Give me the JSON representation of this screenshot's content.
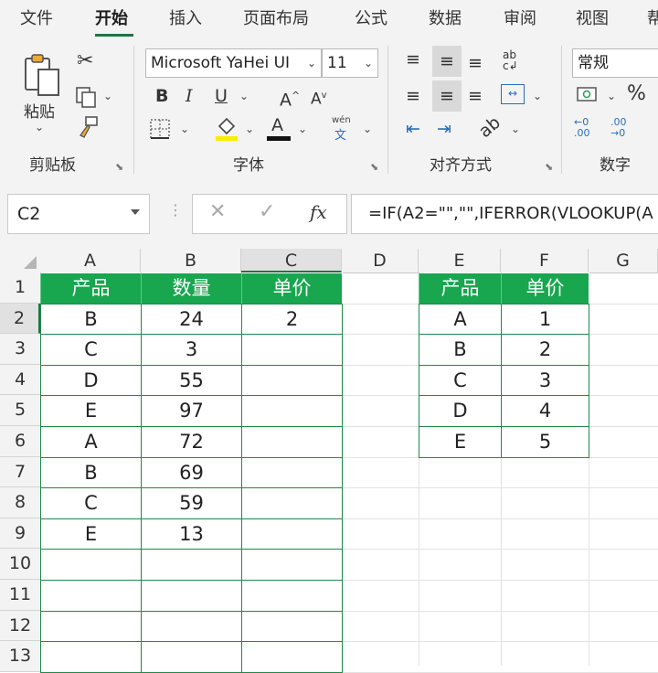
{
  "ribbon": {
    "tabs": [
      "文件",
      "开始",
      "插入",
      "页面布局",
      "公式",
      "数据",
      "审阅",
      "视图",
      "帮"
    ],
    "active_tab": "开始",
    "clipboard": {
      "paste_label": "粘贴",
      "group_label": "剪贴板"
    },
    "font": {
      "font_name": "Microsoft YaHei UI",
      "font_size": "11",
      "group_label": "字体",
      "bold": "B",
      "italic": "I",
      "underline": "U",
      "grow": "A",
      "shrink": "A",
      "font_color_glyph": "A",
      "phonetic_top": "wén",
      "phonetic_bottom": "文"
    },
    "alignment": {
      "group_label": "对齐方式"
    },
    "number": {
      "format": "常规",
      "group_label": "数字",
      "percent": "%"
    }
  },
  "formula_bar": {
    "name_box": "C2",
    "fx": "fx",
    "formula": "=IF(A2=\"\",\"\",IFERROR(VLOOKUP(A"
  },
  "grid": {
    "columns": [
      "A",
      "B",
      "C",
      "D",
      "E",
      "F",
      "G"
    ],
    "rows": [
      "1",
      "2",
      "3",
      "4",
      "5",
      "6",
      "7",
      "8",
      "9",
      "10",
      "11",
      "12",
      "13"
    ],
    "table1": {
      "headers": [
        "产品",
        "数量",
        "单价"
      ],
      "rows": [
        [
          "B",
          "24",
          "2"
        ],
        [
          "C",
          "3",
          ""
        ],
        [
          "D",
          "55",
          ""
        ],
        [
          "E",
          "97",
          ""
        ],
        [
          "A",
          "72",
          ""
        ],
        [
          "B",
          "69",
          ""
        ],
        [
          "C",
          "59",
          ""
        ],
        [
          "E",
          "13",
          ""
        ]
      ]
    },
    "table2": {
      "headers": [
        "产品",
        "单价"
      ],
      "rows": [
        [
          "A",
          "1"
        ],
        [
          "B",
          "2"
        ],
        [
          "C",
          "3"
        ],
        [
          "D",
          "4"
        ],
        [
          "E",
          "5"
        ]
      ]
    }
  },
  "colors": {
    "accent": "#217346",
    "header_fill": "#18a64f",
    "border": "#1e8a4a"
  }
}
